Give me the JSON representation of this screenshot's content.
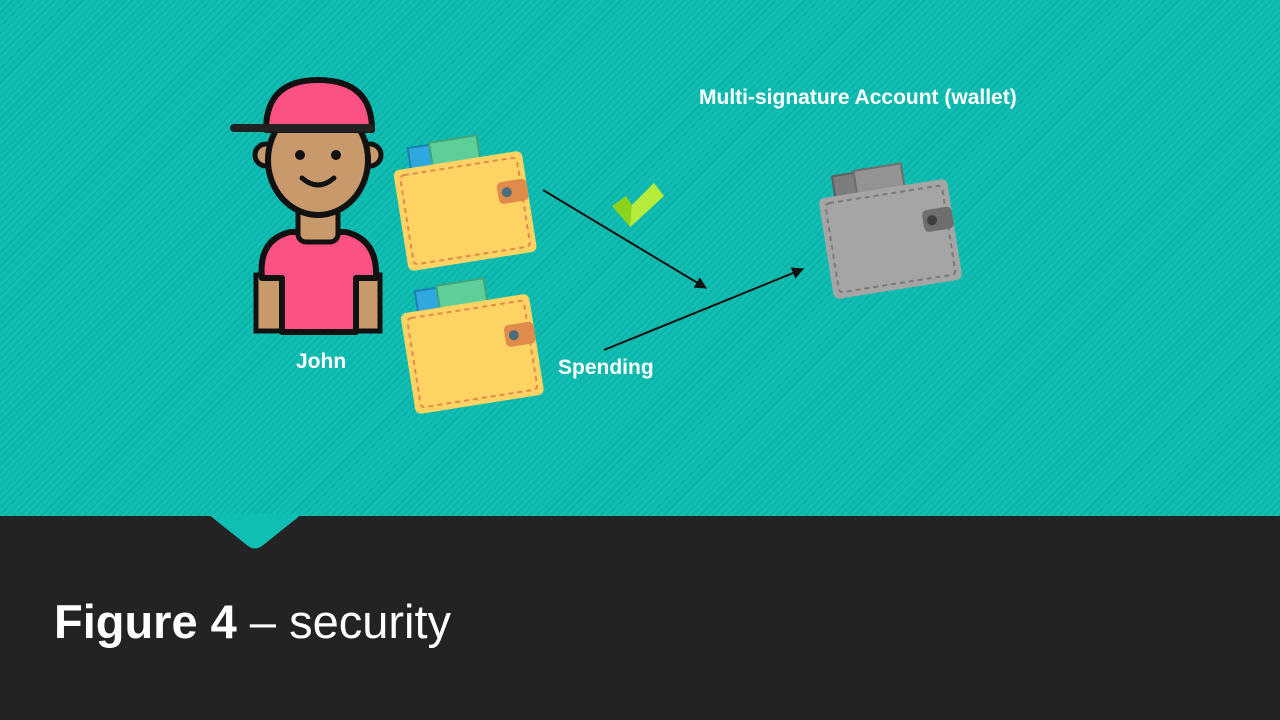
{
  "diagram": {
    "person_name": "John",
    "spending_label": "Spending",
    "multisig_label": "Multi-signature Account (wallet)"
  },
  "caption": {
    "figure_label": "Figure 4",
    "separator": " – ",
    "topic": "security"
  },
  "colors": {
    "background_teal": "#10bfb3",
    "caption_bar": "#232323",
    "wallet_yellow": "#fdd364",
    "wallet_grey": "#a5a5a5",
    "shirt_pink": "#fb5183",
    "checkmark_green": "#8cd31f"
  },
  "icons": [
    "person-icon",
    "wallet-icon",
    "checkmark-icon",
    "arrow-icon"
  ]
}
